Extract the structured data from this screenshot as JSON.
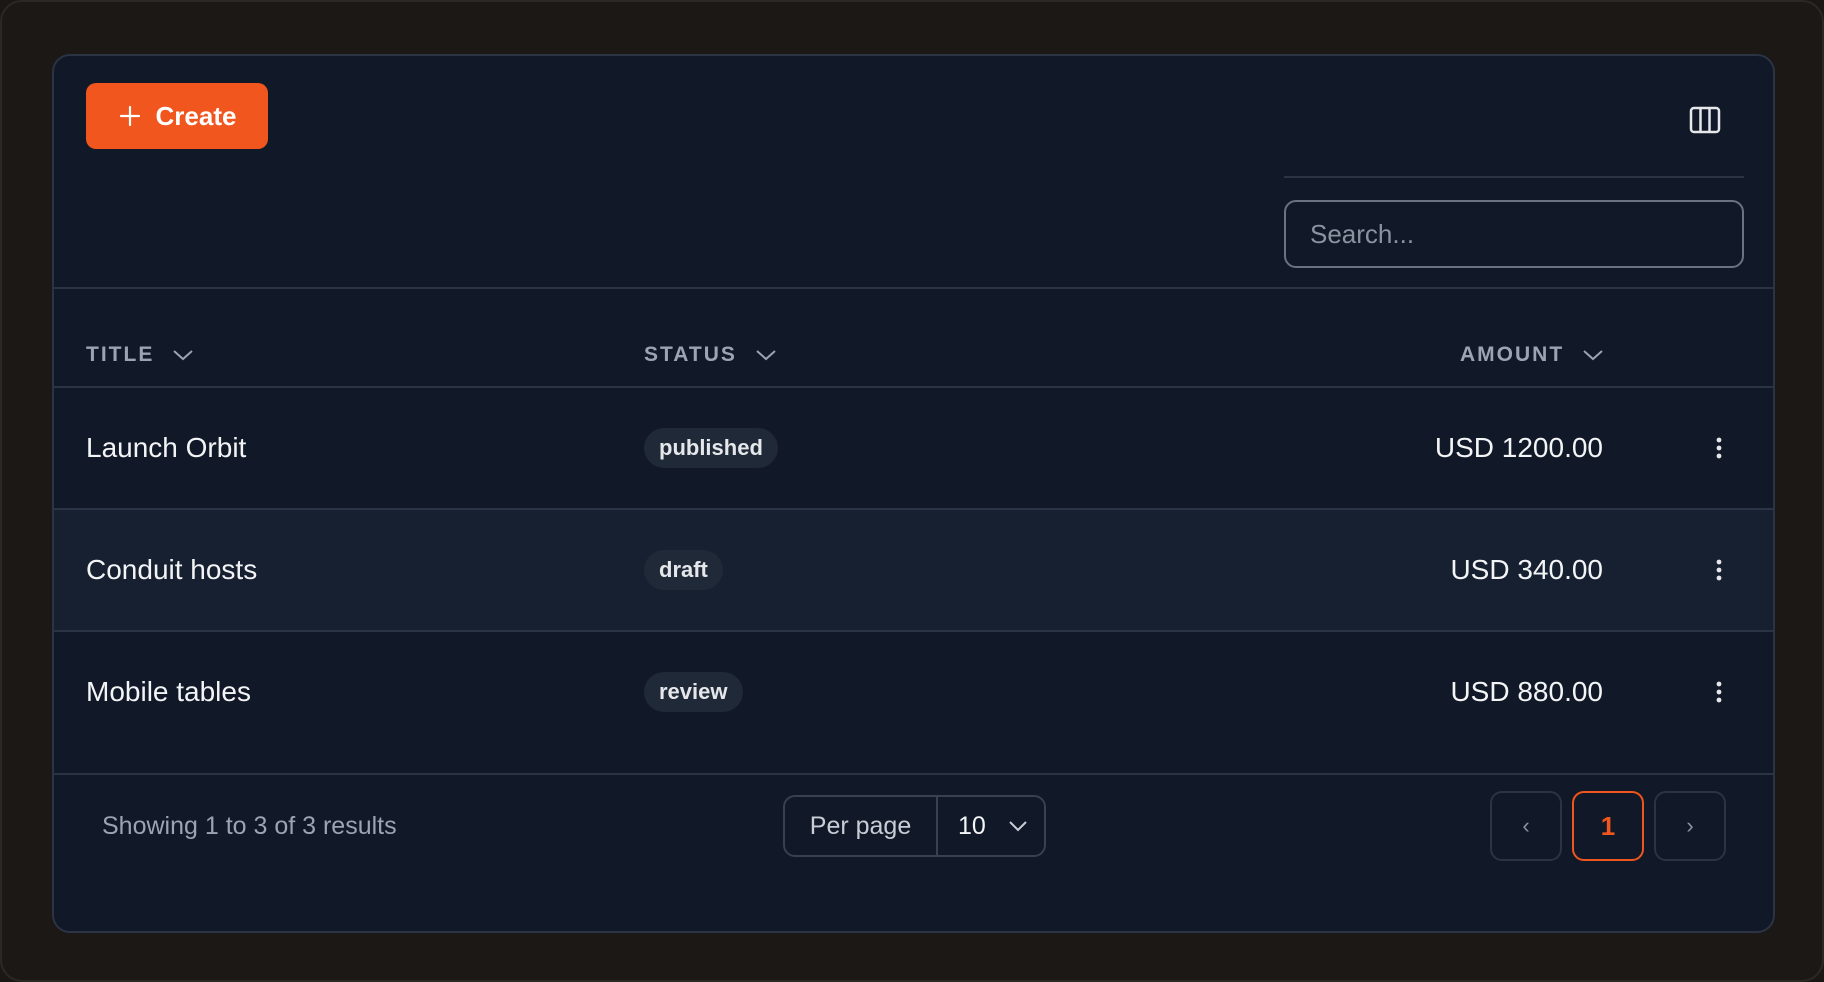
{
  "toolbar": {
    "create_label": "Create",
    "create_icon": "plus-icon",
    "columns_icon": "columns-icon"
  },
  "search": {
    "placeholder": "Search...",
    "value": ""
  },
  "table": {
    "columns": [
      {
        "label": "TITLE",
        "icon": "chevron-down-icon"
      },
      {
        "label": "STATUS",
        "icon": "chevron-down-icon"
      },
      {
        "label": "AMOUNT",
        "icon": "chevron-down-icon"
      }
    ],
    "rows": [
      {
        "title": "Launch Orbit",
        "status": "published",
        "amount": "USD 1200.00"
      },
      {
        "title": "Conduit hosts",
        "status": "draft",
        "amount": "USD 340.00"
      },
      {
        "title": "Mobile tables",
        "status": "review",
        "amount": "USD 880.00"
      }
    ],
    "row_action_icon": "more-vertical-icon"
  },
  "footer": {
    "showing_text": "Showing 1 to 3 of 3 results",
    "per_page_label": "Per page",
    "per_page_value": "10",
    "prev_label": "‹",
    "current_page": "1",
    "next_label": "›"
  },
  "colors": {
    "accent": "#f0561d",
    "panel_bg": "#111827",
    "badge_bg": "#1f2937"
  }
}
